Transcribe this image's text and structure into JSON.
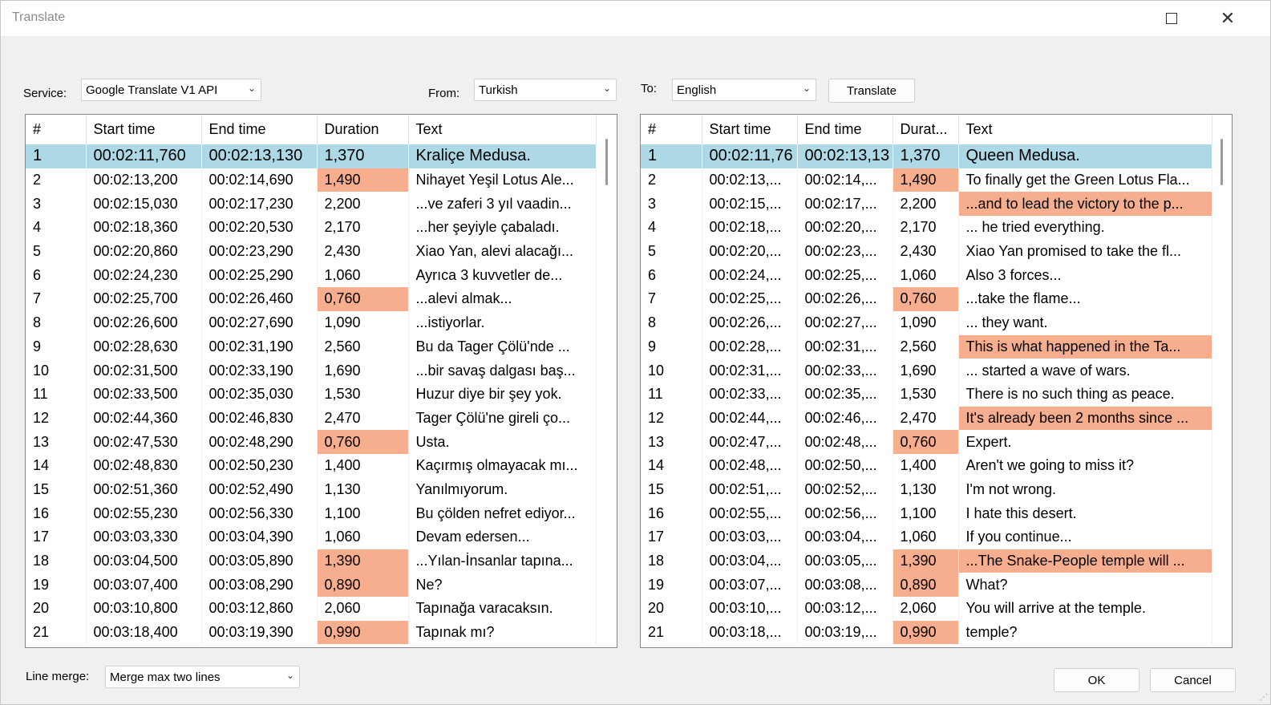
{
  "window": {
    "title": "Translate"
  },
  "service": {
    "label": "Service:",
    "value": "Google Translate V1 API"
  },
  "from": {
    "label": "From:",
    "value": "Turkish"
  },
  "to": {
    "label": "To:",
    "value": "English"
  },
  "translate_button": "Translate",
  "source_grid": {
    "columns": [
      "#",
      "Start time",
      "End time",
      "Duration",
      "Text"
    ],
    "rows": [
      [
        "1",
        "00:02:11,760",
        "00:02:13,130",
        "1,370",
        "Kraliçe Medusa."
      ],
      [
        "2",
        "00:02:13,200",
        "00:02:14,690",
        "1,490",
        "Nihayet Yeşil Lotus Ale..."
      ],
      [
        "3",
        "00:02:15,030",
        "00:02:17,230",
        "2,200",
        "...ve zaferi 3 yıl vaadin..."
      ],
      [
        "4",
        "00:02:18,360",
        "00:02:20,530",
        "2,170",
        "...her şeyiyle çabaladı."
      ],
      [
        "5",
        "00:02:20,860",
        "00:02:23,290",
        "2,430",
        "Xiao Yan, alevi alacağı..."
      ],
      [
        "6",
        "00:02:24,230",
        "00:02:25,290",
        "1,060",
        "Ayrıca 3 kuvvetler de..."
      ],
      [
        "7",
        "00:02:25,700",
        "00:02:26,460",
        "0,760",
        "...alevi almak..."
      ],
      [
        "8",
        "00:02:26,600",
        "00:02:27,690",
        "1,090",
        "...istiyorlar."
      ],
      [
        "9",
        "00:02:28,630",
        "00:02:31,190",
        "2,560",
        "Bu da Tager Çölü'nde ..."
      ],
      [
        "10",
        "00:02:31,500",
        "00:02:33,190",
        "1,690",
        "...bir savaş dalgası baş..."
      ],
      [
        "11",
        "00:02:33,500",
        "00:02:35,030",
        "1,530",
        "Huzur diye bir şey yok."
      ],
      [
        "12",
        "00:02:44,360",
        "00:02:46,830",
        "2,470",
        "Tager Çölü'ne gireli ço..."
      ],
      [
        "13",
        "00:02:47,530",
        "00:02:48,290",
        "0,760",
        "Usta."
      ],
      [
        "14",
        "00:02:48,830",
        "00:02:50,230",
        "1,400",
        "Kaçırmış olmayacak mı..."
      ],
      [
        "15",
        "00:02:51,360",
        "00:02:52,490",
        "1,130",
        "Yanılmıyorum."
      ],
      [
        "16",
        "00:02:55,230",
        "00:02:56,330",
        "1,100",
        "Bu çölden nefret ediyor..."
      ],
      [
        "17",
        "00:03:03,330",
        "00:03:04,390",
        "1,060",
        "Devam edersen..."
      ],
      [
        "18",
        "00:03:04,500",
        "00:03:05,890",
        "1,390",
        "...Yılan-İnsanlar tapına..."
      ],
      [
        "19",
        "00:03:07,400",
        "00:03:08,290",
        "0,890",
        "Ne?"
      ],
      [
        "20",
        "00:03:10,800",
        "00:03:12,860",
        "2,060",
        "Tapınağa varacaksın."
      ],
      [
        "21",
        "00:03:18,400",
        "00:03:19,390",
        "0,990",
        "Tapınak mı?"
      ]
    ],
    "warn_duration_rows": [
      2,
      7,
      13,
      18,
      19,
      21
    ]
  },
  "target_grid": {
    "columns": [
      "#",
      "Start time",
      "End time",
      "Durat...",
      "Text"
    ],
    "rows": [
      [
        "1",
        "00:02:11,76",
        "00:02:13,13",
        "1,370",
        "Queen Medusa."
      ],
      [
        "2",
        "00:02:13,...",
        "00:02:14,...",
        "1,490",
        "To finally get the Green Lotus Fla..."
      ],
      [
        "3",
        "00:02:15,...",
        "00:02:17,...",
        "2,200",
        "...and to lead the victory to the p..."
      ],
      [
        "4",
        "00:02:18,...",
        "00:02:20,...",
        "2,170",
        "... he tried everything."
      ],
      [
        "5",
        "00:02:20,...",
        "00:02:23,...",
        "2,430",
        "Xiao Yan promised to take the fl..."
      ],
      [
        "6",
        "00:02:24,...",
        "00:02:25,...",
        "1,060",
        "Also 3 forces..."
      ],
      [
        "7",
        "00:02:25,...",
        "00:02:26,...",
        "0,760",
        "...take the flame..."
      ],
      [
        "8",
        "00:02:26,...",
        "00:02:27,...",
        "1,090",
        "... they want."
      ],
      [
        "9",
        "00:02:28,...",
        "00:02:31,...",
        "2,560",
        "This is what happened in the Ta..."
      ],
      [
        "10",
        "00:02:31,...",
        "00:02:33,...",
        "1,690",
        "... started a wave of wars."
      ],
      [
        "11",
        "00:02:33,...",
        "00:02:35,...",
        "1,530",
        "There is no such thing as peace."
      ],
      [
        "12",
        "00:02:44,...",
        "00:02:46,...",
        "2,470",
        "It's already been 2 months since ..."
      ],
      [
        "13",
        "00:02:47,...",
        "00:02:48,...",
        "0,760",
        "Expert."
      ],
      [
        "14",
        "00:02:48,...",
        "00:02:50,...",
        "1,400",
        "Aren't we going to miss it?"
      ],
      [
        "15",
        "00:02:51,...",
        "00:02:52,...",
        "1,130",
        "I'm not wrong."
      ],
      [
        "16",
        "00:02:55,...",
        "00:02:56,...",
        "1,100",
        "I hate this desert."
      ],
      [
        "17",
        "00:03:03,...",
        "00:03:04,...",
        "1,060",
        "If you continue..."
      ],
      [
        "18",
        "00:03:04,...",
        "00:03:05,...",
        "1,390",
        "...The Snake-People temple will ..."
      ],
      [
        "19",
        "00:03:07,...",
        "00:03:08,...",
        "0,890",
        "What?"
      ],
      [
        "20",
        "00:03:10,...",
        "00:03:12,...",
        "2,060",
        "You will arrive at the temple."
      ],
      [
        "21",
        "00:03:18,...",
        "00:03:19,...",
        "0,990",
        "temple?"
      ]
    ],
    "warn_duration_rows": [
      2,
      7,
      13,
      18,
      19,
      21
    ],
    "warn_text_rows": [
      3,
      9,
      12,
      18
    ]
  },
  "selected_row": 1,
  "line_merge": {
    "label": "Line merge:",
    "value": "Merge max two lines"
  },
  "ok_button": "OK",
  "cancel_button": "Cancel",
  "colors": {
    "selection": "#add8e6",
    "warning": "#f7ae8f"
  }
}
